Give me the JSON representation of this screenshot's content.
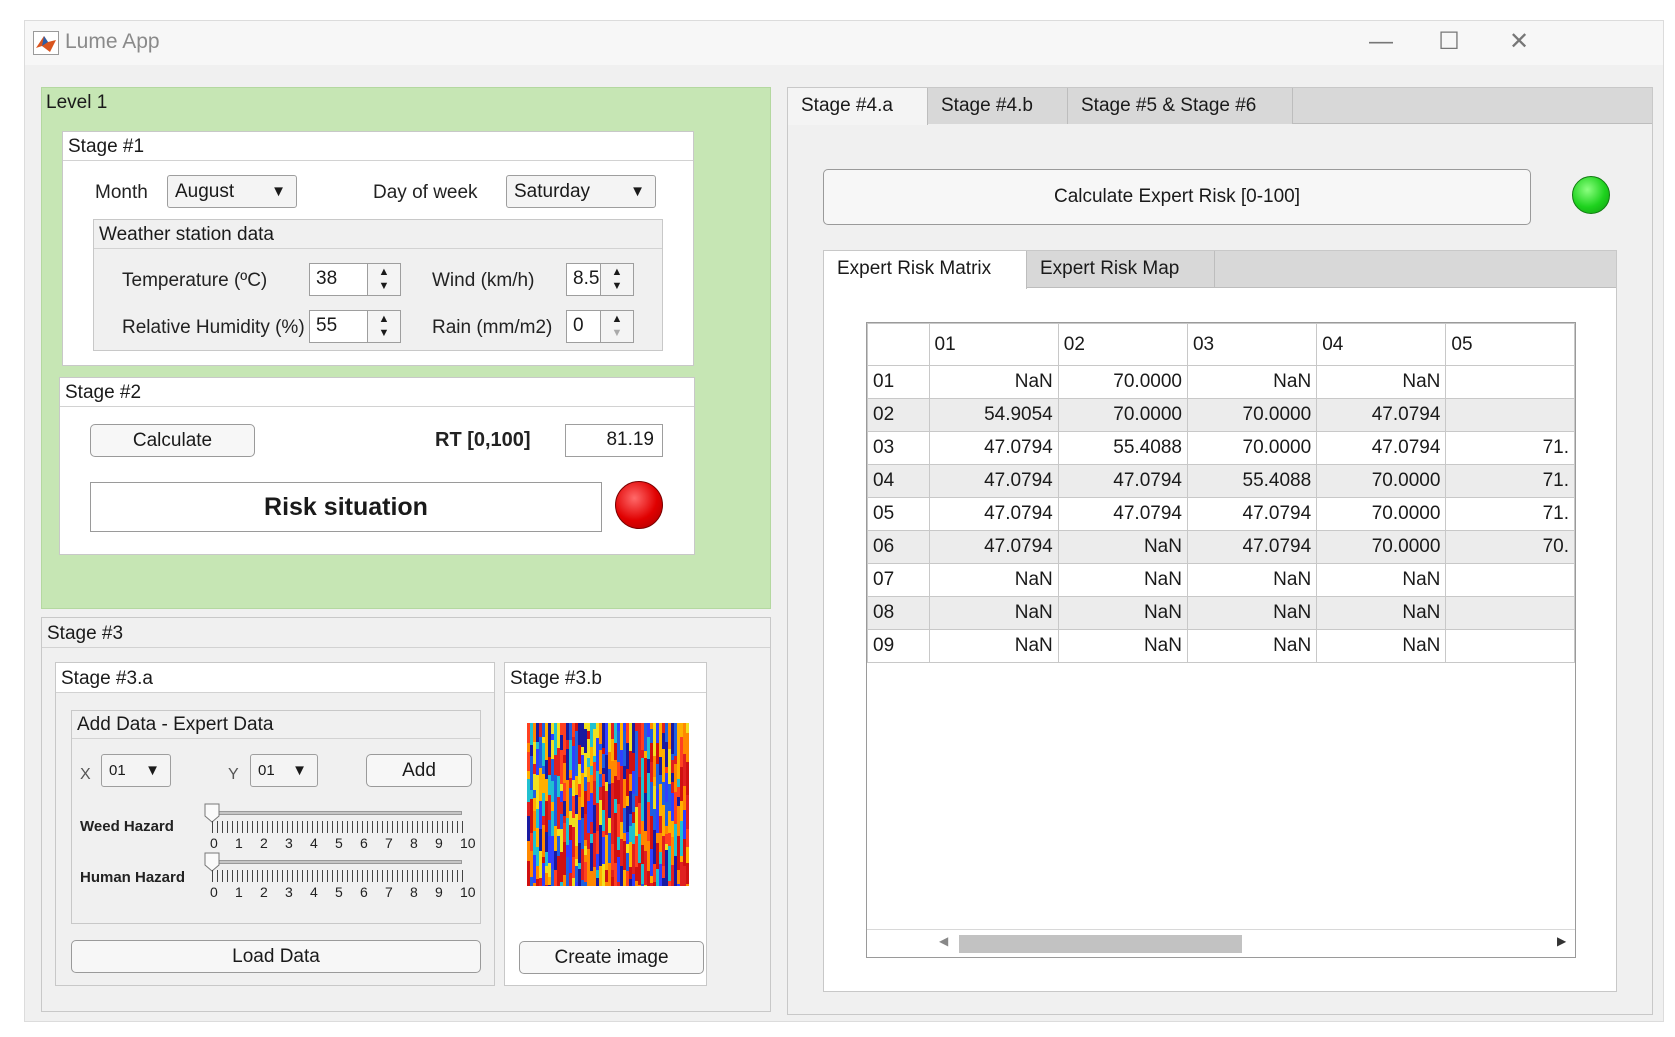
{
  "window": {
    "title": "Lume App"
  },
  "level1": {
    "title": "Level 1",
    "stage1": {
      "title": "Stage #1",
      "month_label": "Month",
      "month_value": "August",
      "day_label": "Day of week",
      "day_value": "Saturday",
      "weather": {
        "title": "Weather station data",
        "temperature_label": "Temperature (ºC)",
        "temperature_value": "38",
        "wind_label": "Wind (km/h)",
        "wind_value": "8.5",
        "humidity_label": "Relative Humidity (%)",
        "humidity_value": "55",
        "rain_label": "Rain (mm/m2)",
        "rain_value": "0"
      }
    },
    "stage2": {
      "title": "Stage #2",
      "calculate_label": "Calculate",
      "rt_label": "RT [0,100]",
      "rt_value": "81.19",
      "status_text": "Risk situation",
      "lamp_color": "#e00000"
    }
  },
  "stage3": {
    "title": "Stage #3",
    "a": {
      "title": "Stage #3.a",
      "add_data_title": "Add Data - Expert Data",
      "x_label": "X",
      "x_value": "01",
      "y_label": "Y",
      "y_value": "01",
      "add_label": "Add",
      "weed_label": "Weed Hazard",
      "weed_value": 0,
      "human_label": "Human Hazard",
      "human_value": 0,
      "scale": [
        "0",
        "1",
        "2",
        "3",
        "4",
        "5",
        "6",
        "7",
        "8",
        "9",
        "10"
      ],
      "load_label": "Load Data"
    },
    "b": {
      "title": "Stage #3.b",
      "create_label": "Create image"
    }
  },
  "right": {
    "tabs": [
      "Stage #4.a",
      "Stage #4.b",
      "Stage #5 & Stage #6"
    ],
    "calc_expert_label": "Calculate Expert Risk [0-100]",
    "lamp_color": "#1ed21e",
    "subtabs": [
      "Expert Risk Matrix",
      "Expert Risk Map"
    ],
    "matrix": {
      "columns": [
        "01",
        "02",
        "03",
        "04",
        "05"
      ],
      "rows": [
        {
          "label": "01",
          "cells": [
            "NaN",
            "70.0000",
            "NaN",
            "NaN",
            ""
          ]
        },
        {
          "label": "02",
          "cells": [
            "54.9054",
            "70.0000",
            "70.0000",
            "47.0794",
            ""
          ]
        },
        {
          "label": "03",
          "cells": [
            "47.0794",
            "55.4088",
            "70.0000",
            "47.0794",
            "71."
          ]
        },
        {
          "label": "04",
          "cells": [
            "47.0794",
            "47.0794",
            "55.4088",
            "70.0000",
            "71."
          ]
        },
        {
          "label": "05",
          "cells": [
            "47.0794",
            "47.0794",
            "47.0794",
            "70.0000",
            "71."
          ]
        },
        {
          "label": "06",
          "cells": [
            "47.0794",
            "NaN",
            "47.0794",
            "70.0000",
            "70."
          ]
        },
        {
          "label": "07",
          "cells": [
            "NaN",
            "NaN",
            "NaN",
            "NaN",
            ""
          ]
        },
        {
          "label": "08",
          "cells": [
            "NaN",
            "NaN",
            "NaN",
            "NaN",
            ""
          ]
        },
        {
          "label": "09",
          "cells": [
            "NaN",
            "NaN",
            "NaN",
            "NaN",
            ""
          ]
        }
      ]
    }
  }
}
